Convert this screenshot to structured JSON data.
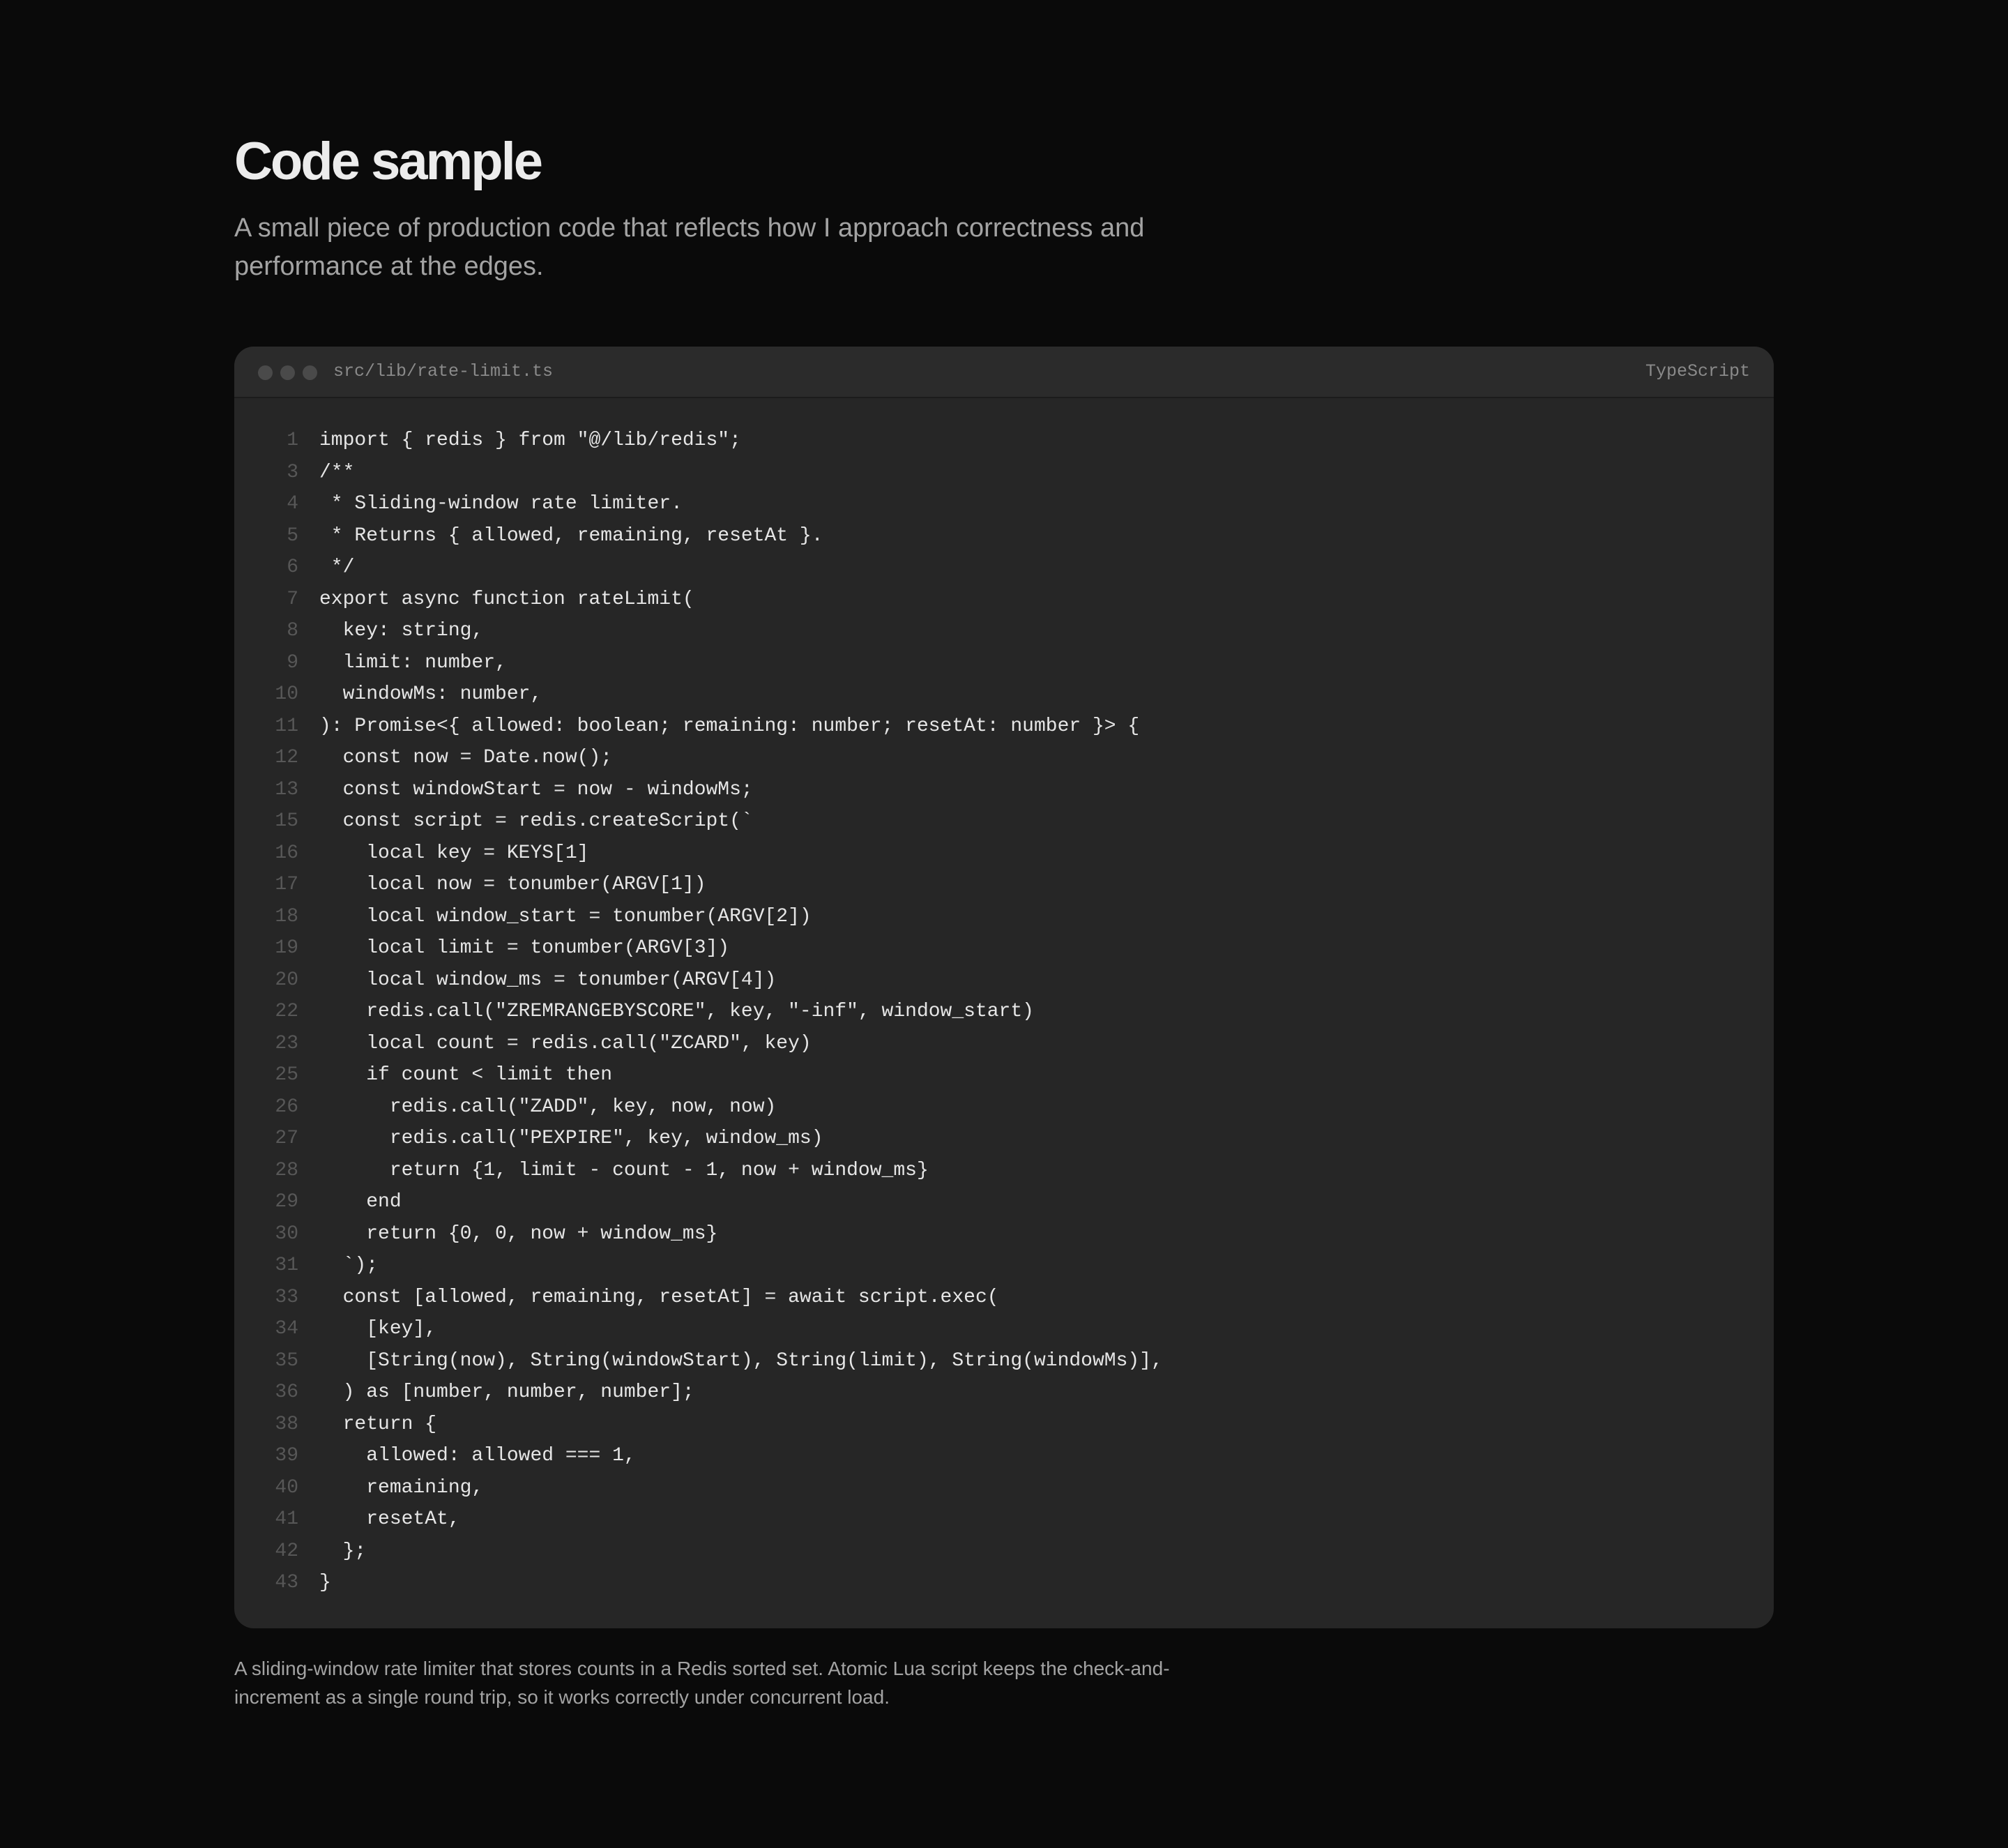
{
  "header": {
    "title": "Code sample",
    "subtitle": "A small piece of production code that reflects how I approach correctness and performance at the edges."
  },
  "code_window": {
    "filename": "src/lib/rate-limit.ts",
    "language": "TypeScript",
    "lines": [
      {
        "no": "1",
        "code": "import { redis } from \"@/lib/redis\";"
      },
      {
        "no": "3",
        "code": "/**"
      },
      {
        "no": "4",
        "code": " * Sliding-window rate limiter."
      },
      {
        "no": "5",
        "code": " * Returns { allowed, remaining, resetAt }."
      },
      {
        "no": "6",
        "code": " */"
      },
      {
        "no": "7",
        "code": "export async function rateLimit("
      },
      {
        "no": "8",
        "code": "  key: string,"
      },
      {
        "no": "9",
        "code": "  limit: number,"
      },
      {
        "no": "10",
        "code": "  windowMs: number,"
      },
      {
        "no": "11",
        "code": "): Promise<{ allowed: boolean; remaining: number; resetAt: number }> {"
      },
      {
        "no": "12",
        "code": "  const now = Date.now();"
      },
      {
        "no": "13",
        "code": "  const windowStart = now - windowMs;"
      },
      {
        "no": "15",
        "code": "  const script = redis.createScript(`"
      },
      {
        "no": "16",
        "code": "    local key = KEYS[1]"
      },
      {
        "no": "17",
        "code": "    local now = tonumber(ARGV[1])"
      },
      {
        "no": "18",
        "code": "    local window_start = tonumber(ARGV[2])"
      },
      {
        "no": "19",
        "code": "    local limit = tonumber(ARGV[3])"
      },
      {
        "no": "20",
        "code": "    local window_ms = tonumber(ARGV[4])"
      },
      {
        "no": "22",
        "code": "    redis.call(\"ZREMRANGEBYSCORE\", key, \"-inf\", window_start)"
      },
      {
        "no": "23",
        "code": "    local count = redis.call(\"ZCARD\", key)"
      },
      {
        "no": "25",
        "code": "    if count < limit then"
      },
      {
        "no": "26",
        "code": "      redis.call(\"ZADD\", key, now, now)"
      },
      {
        "no": "27",
        "code": "      redis.call(\"PEXPIRE\", key, window_ms)"
      },
      {
        "no": "28",
        "code": "      return {1, limit - count - 1, now + window_ms}"
      },
      {
        "no": "29",
        "code": "    end"
      },
      {
        "no": "30",
        "code": "    return {0, 0, now + window_ms}"
      },
      {
        "no": "31",
        "code": "  `);"
      },
      {
        "no": "33",
        "code": "  const [allowed, remaining, resetAt] = await script.exec("
      },
      {
        "no": "34",
        "code": "    [key],"
      },
      {
        "no": "35",
        "code": "    [String(now), String(windowStart), String(limit), String(windowMs)],"
      },
      {
        "no": "36",
        "code": "  ) as [number, number, number];"
      },
      {
        "no": "38",
        "code": "  return {"
      },
      {
        "no": "39",
        "code": "    allowed: allowed === 1,"
      },
      {
        "no": "40",
        "code": "    remaining,"
      },
      {
        "no": "41",
        "code": "    resetAt,"
      },
      {
        "no": "42",
        "code": "  };"
      },
      {
        "no": "43",
        "code": "}"
      }
    ]
  },
  "caption": "A sliding-window rate limiter that stores counts in a Redis sorted set. Atomic Lua script keeps the check-and-increment as a single round trip, so it works correctly under concurrent load."
}
